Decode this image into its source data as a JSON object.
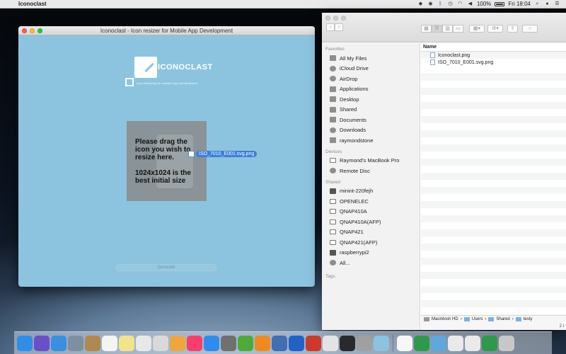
{
  "menubar": {
    "app_name": "Iconoclast",
    "battery": "100%",
    "clock": "Fri 18:04"
  },
  "app_window": {
    "title": "Iconoclast - Icon resizer for Mobile App Development",
    "logo_title": "ICONOCLAST",
    "logo_subtitle": "Icon Resizing for mobile app development",
    "drop_text_1": "Please drag the icon you wish to resize here.",
    "drop_text_2": "1024x1024 is the best initial size",
    "dragged_file": "ISO_7010_E001.svg.png",
    "generate_label": "Generate"
  },
  "finder": {
    "sidebar": {
      "favorites_label": "Favorites",
      "favorites": [
        "All My Files",
        "iCloud Drive",
        "AirDrop",
        "Applications",
        "Desktop",
        "Shared",
        "Documents",
        "Downloads",
        "raymondstone"
      ],
      "devices_label": "Devices",
      "devices": [
        "Raymond's MacBook Pro",
        "Remote Disc"
      ],
      "shared_label": "Shared",
      "shared": [
        "minint-220fejh",
        "OPENELEC",
        "QNAP410A",
        "QNAP410A(AFP)",
        "QNAP421",
        "QNAP421(AFP)",
        "raspberrypi2",
        "All..."
      ],
      "tags_label": "Tags"
    },
    "column_name": "Name",
    "files": [
      "Iconoclast.png",
      "ISO_7010_E001.svg.png"
    ],
    "path": [
      "Macintosh HD",
      "Users",
      "Shared",
      "testy"
    ],
    "status": "2 i"
  },
  "colors": {
    "app_bg": "#8cc4df",
    "drop_bg": "#8a9397",
    "highlight": "#3d7ed8"
  }
}
